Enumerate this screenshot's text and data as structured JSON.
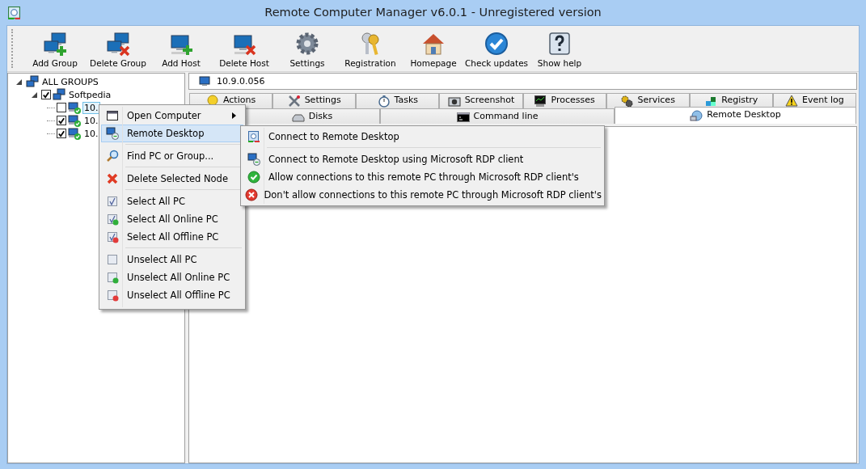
{
  "window": {
    "title": "Remote Computer Manager v6.0.1 - Unregistered version"
  },
  "toolbar": [
    {
      "label": "Add Group"
    },
    {
      "label": "Delete Group"
    },
    {
      "label": "Add Host"
    },
    {
      "label": "Delete Host"
    },
    {
      "label": "Settings"
    },
    {
      "label": "Registration"
    },
    {
      "label": "Homepage"
    },
    {
      "label": "Check updates"
    },
    {
      "label": "Show help"
    }
  ],
  "tree": [
    {
      "label": "ALL GROUPS",
      "expanded": true,
      "children": [
        {
          "label": "Softpedia",
          "expanded": true,
          "checked": true,
          "children": [
            {
              "label": "10.",
              "checked": false,
              "selected": true
            },
            {
              "label": "10.",
              "checked": true,
              "selected": false
            },
            {
              "label": "10.",
              "checked": true,
              "selected": false
            }
          ]
        }
      ]
    }
  ],
  "address": {
    "value": "10.9.0.056"
  },
  "tabs_row_1": [
    {
      "label": "Actions",
      "selected": false
    },
    {
      "label": "Settings",
      "selected": false
    },
    {
      "label": "Tasks",
      "selected": false
    },
    {
      "label": "Screenshot",
      "selected": false
    },
    {
      "label": "Processes",
      "selected": false
    },
    {
      "label": "Services",
      "selected": false
    },
    {
      "label": "Registry",
      "selected": false
    },
    {
      "label": "Event log",
      "selected": false
    }
  ],
  "tabs_row_2": [
    {
      "label": "Disks",
      "selected": false
    },
    {
      "label": "Command line",
      "selected": false
    },
    {
      "label": "Remote Desktop",
      "selected": true
    }
  ],
  "context_menu": {
    "groups": [
      {
        "items": [
          {
            "label": "Open Computer",
            "submenu": true,
            "selected": false
          },
          {
            "label": "Remote Desktop",
            "submenu": false,
            "selected": true
          }
        ]
      },
      {
        "items": [
          {
            "label": "Find PC or Group...",
            "submenu": false,
            "selected": false
          }
        ]
      },
      {
        "items": [
          {
            "label": "Delete Selected Node",
            "submenu": false,
            "selected": false
          }
        ]
      },
      {
        "items": [
          {
            "label": "Select All PC",
            "submenu": false,
            "selected": false
          },
          {
            "label": "Select All Online PC",
            "submenu": false,
            "selected": false
          },
          {
            "label": "Select All Offline PC",
            "submenu": false,
            "selected": false
          }
        ]
      },
      {
        "items": [
          {
            "label": "Unselect All PC",
            "submenu": false,
            "selected": false
          },
          {
            "label": "Unselect All Online PC",
            "submenu": false,
            "selected": false
          },
          {
            "label": "Unselect All Offline PC",
            "submenu": false,
            "selected": false
          }
        ]
      }
    ]
  },
  "submenu": {
    "groups": [
      {
        "items": [
          {
            "label": "Connect to Remote Desktop"
          }
        ]
      },
      {
        "items": [
          {
            "label": "Connect to Remote Desktop using Microsoft RDP client"
          },
          {
            "label": "Allow connections to this remote PC through Microsoft RDP client's"
          },
          {
            "label": "Don't allow connections to this remote PC through Microsoft RDP client's"
          }
        ]
      }
    ]
  }
}
